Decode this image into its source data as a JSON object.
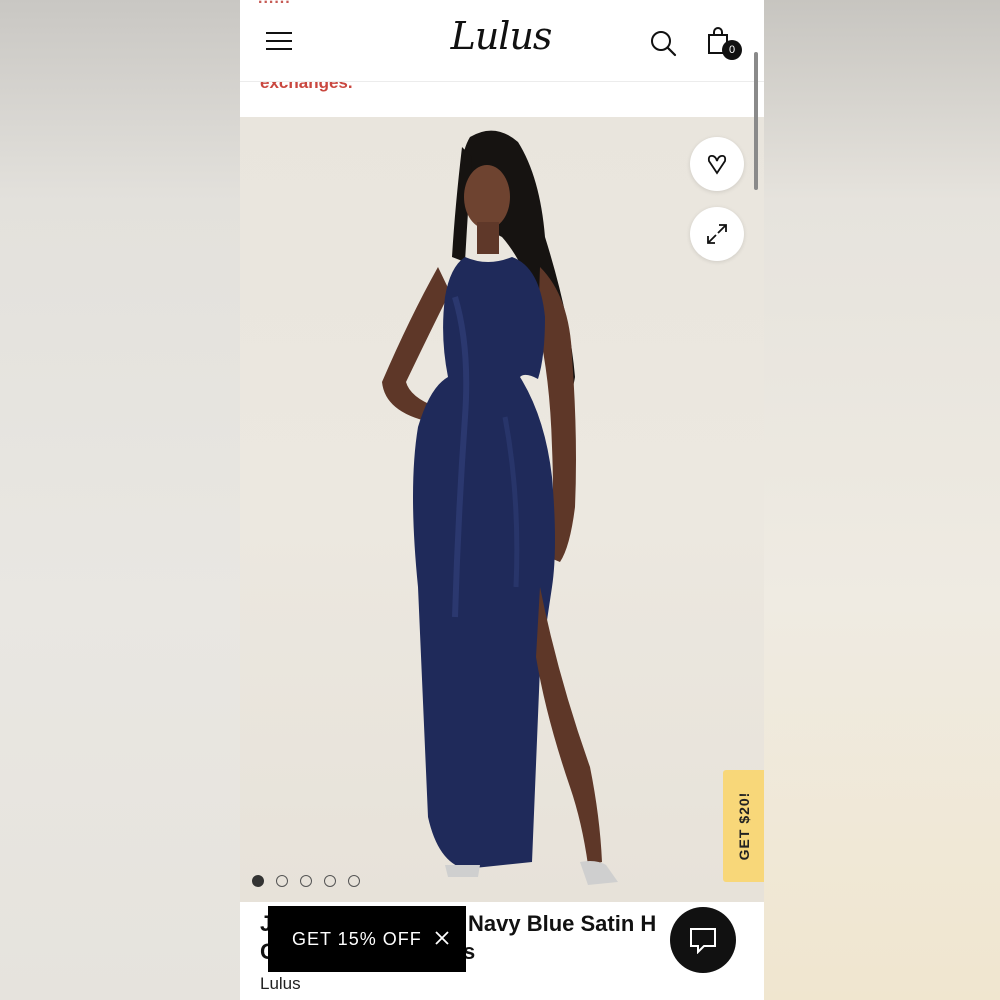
{
  "header": {
    "promo_text_cut": "......",
    "logo": "Lulus",
    "bag_count": "0",
    "exchanges_text": "exchanges."
  },
  "gallery": {
    "slides": 5,
    "active_slide": 1,
    "side_tab": "GET $20!"
  },
  "product": {
    "title_line1_start": "J",
    "title_line1_visible": "Navy Blue Satin H",
    "title_line2_start": "C",
    "title_line2_end": "s",
    "brand": "Lulus"
  },
  "overlay": {
    "promo_label": "GET 15% OFF"
  },
  "colors": {
    "accent_red": "#c9473f",
    "tab_yellow": "#f8d779",
    "dress_navy": "#1f2a5a"
  },
  "icons": [
    "menu-icon",
    "search-icon",
    "shopping-bag-icon",
    "heart-icon",
    "expand-icon",
    "close-icon",
    "chat-icon"
  ]
}
